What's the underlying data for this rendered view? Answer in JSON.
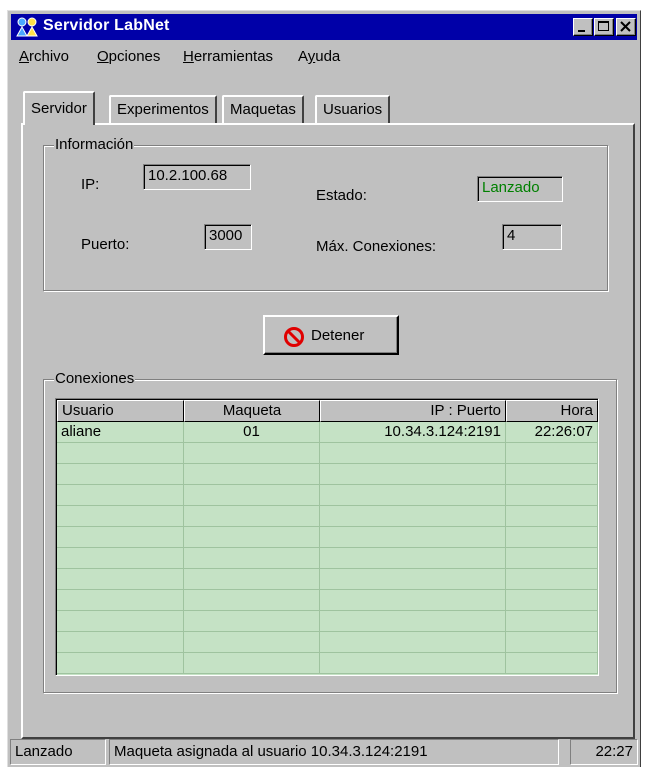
{
  "window": {
    "title": "Servidor LabNet"
  },
  "menu": [
    {
      "label": "Archivo",
      "mnemonic": "A",
      "rest": "rchivo"
    },
    {
      "label": "Opciones",
      "mnemonic": "O",
      "rest": "pciones"
    },
    {
      "label": "Herramientas",
      "mnemonic": "H",
      "rest": "erramientas"
    },
    {
      "label": "Ayuda",
      "pre": "A",
      "mnemonic": "y",
      "rest": "uda"
    }
  ],
  "tabs": [
    "Servidor",
    "Experimentos",
    "Maquetas",
    "Usuarios"
  ],
  "info": {
    "legend": "Información",
    "ip_label": "IP:",
    "ip_value": "10.2.100.68",
    "port_label": "Puerto:",
    "port_value": "3000",
    "state_label": "Estado:",
    "state_value": "Lanzado",
    "maxconn_label": "Máx. Conexiones:",
    "maxconn_value": "4"
  },
  "stop_button": {
    "label": "Detener",
    "icon": "stop-icon"
  },
  "connections": {
    "legend": "Conexiones",
    "columns": [
      "Usuario",
      "Maqueta",
      "IP : Puerto",
      "Hora"
    ],
    "rows": [
      {
        "usuario": "aliane",
        "maqueta": "01",
        "ip_puerto": "10.34.3.124:2191",
        "hora": "22:26:07"
      }
    ]
  },
  "status": {
    "state": "Lanzado",
    "message": "Maqueta asignada al usuario 10.34.3.124:2191",
    "time": "22:27"
  },
  "colors": {
    "titlebar": "#0000a8",
    "face": "#c0c0c0",
    "list_bg": "#c5e2c5",
    "state_text": "#008000"
  }
}
